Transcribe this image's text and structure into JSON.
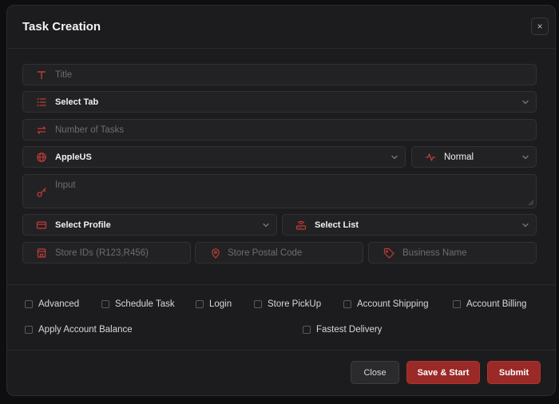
{
  "dialog": {
    "title": "Task Creation",
    "close_symbol": "×"
  },
  "fields": {
    "title": {
      "placeholder": "Title"
    },
    "select_tab": {
      "value": "Select Tab"
    },
    "number_of_tasks": {
      "placeholder": "Number of Tasks"
    },
    "store": {
      "value": "AppleUS"
    },
    "mode": {
      "value": "Normal"
    },
    "input": {
      "placeholder": "Input"
    },
    "profile": {
      "value": "Select Profile"
    },
    "list": {
      "value": "Select List"
    },
    "store_ids": {
      "placeholder": "Store IDs (R123,R456)"
    },
    "postal_code": {
      "placeholder": "Store Postal Code"
    },
    "business_name": {
      "placeholder": "Business Name"
    }
  },
  "options": [
    "Advanced",
    "Schedule Task",
    "Login",
    "Store PickUp",
    "Account Shipping",
    "Account Billing",
    "Apply Account Balance",
    "Fastest Delivery"
  ],
  "buttons": {
    "close": "Close",
    "save_start": "Save & Start",
    "submit": "Submit"
  },
  "colors": {
    "accent": "#c23b36",
    "button_red": "#9a2a27",
    "background": "#1c1c1e"
  },
  "icons": {
    "title": "type-icon",
    "select_tab": "list-icon",
    "number_of_tasks": "repeat-icon",
    "store": "globe-icon",
    "mode": "activity-icon",
    "input": "key-icon",
    "profile": "credit-card-icon",
    "list": "router-icon",
    "store_ids": "store-icon",
    "postal_code": "map-pin-icon",
    "business_name": "tag-icon",
    "chevron": "chevron-down-icon"
  }
}
